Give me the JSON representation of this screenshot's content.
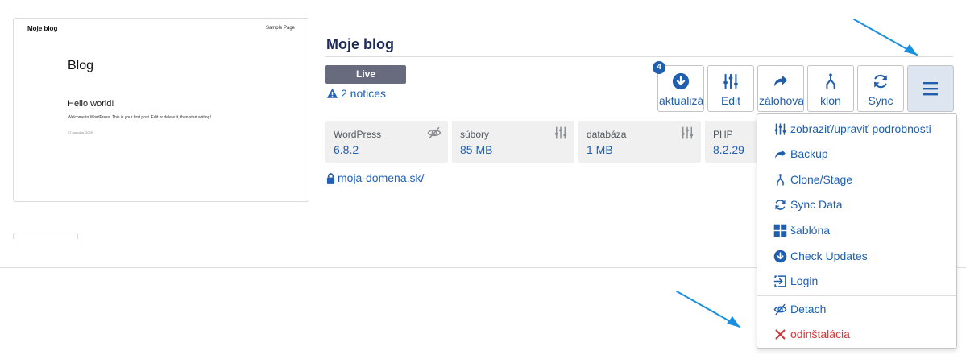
{
  "preview": {
    "site_name": "Moje blog",
    "nav_link": "Sample Page",
    "heading": "Blog",
    "post_title": "Hello world!",
    "excerpt": "Welcome to WordPress. This is your first post. Edit or delete it, then start writing!",
    "date": "27 augusta, 2025"
  },
  "site": {
    "title": "Moje blog",
    "status": "Live",
    "notices": "2 notices",
    "domain": "moja-domena.sk/"
  },
  "actions": {
    "update_count": "4",
    "update_label": "aktualizá",
    "edit_label": "Edit",
    "backup_label": "zálohova",
    "clone_label": "klon",
    "sync_label": "Sync"
  },
  "stats": [
    {
      "label": "WordPress",
      "value": "6.8.2",
      "icon": "eye-slash-icon"
    },
    {
      "label": "súbory",
      "value": "85 MB",
      "icon": "sliders-icon"
    },
    {
      "label": "databáza",
      "value": "1 MB",
      "icon": "sliders-icon"
    },
    {
      "label": "PHP",
      "value": "8.2.29",
      "icon": ""
    }
  ],
  "menu": {
    "details": "zobraziť/upraviť podrobnosti",
    "backup": "Backup",
    "clone": "Clone/Stage",
    "sync": "Sync Data",
    "template": "šablóna",
    "check_updates": "Check Updates",
    "login": "Login",
    "detach": "Detach",
    "uninstall": "odinštalácia"
  },
  "colors": {
    "accent": "#1f5fae",
    "badge": "#686a7e",
    "danger": "#d63638",
    "annotation_arrow": "#1a8fe0"
  }
}
